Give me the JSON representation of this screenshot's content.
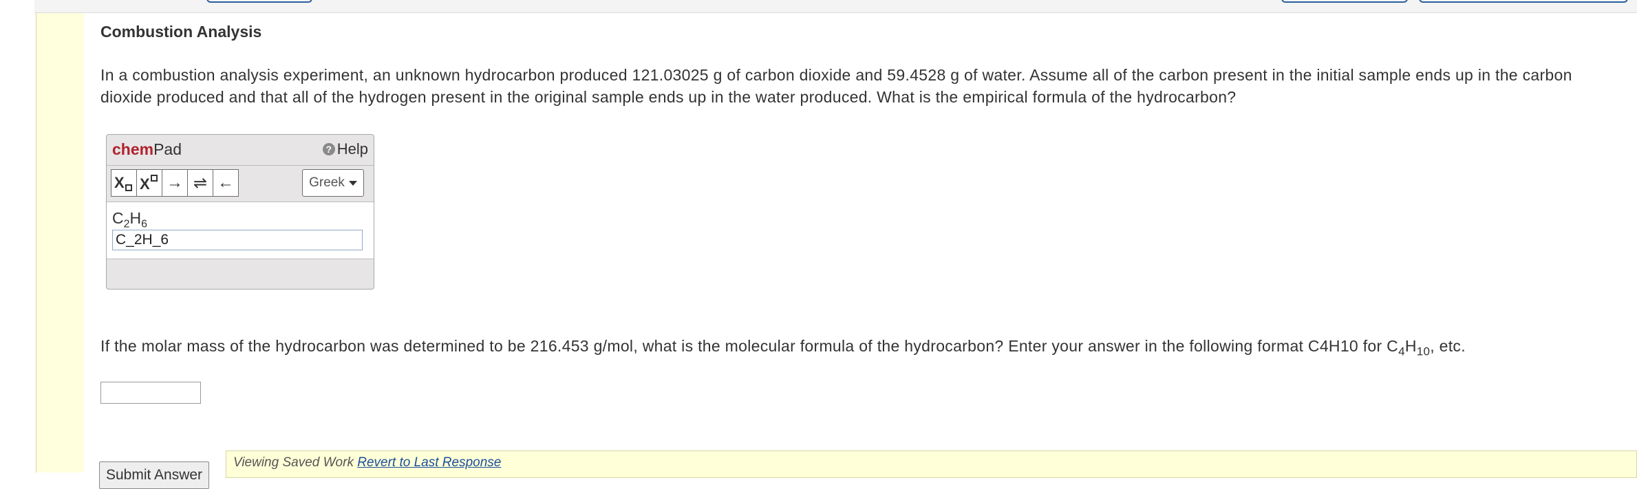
{
  "colors": {
    "rail": "#ffffdd",
    "chem_brand": "#b1212c",
    "link": "#1a4f9c",
    "saved_bar": "#ffffd8"
  },
  "question": {
    "title": "Combustion Analysis",
    "text1": "In a combustion analysis experiment, an unknown hydrocarbon produced 121.03025 g of carbon dioxide and 59.4528 g of water. Assume all of the carbon present in the initial sample ends up in the carbon dioxide produced and that all of the hydrogen present in the original sample ends up in the water produced. What is the empirical formula of the hydrocarbon?",
    "text2_main": "If the molar mass of the hydrocarbon was determined to be 216.453 g/mol, what is the molecular formula of the hydrocarbon? Enter your answer in the following format C4H10 for C",
    "text2_sub1": "4",
    "text2_mid": "H",
    "text2_sub2": "10",
    "text2_end": ", etc."
  },
  "chempad": {
    "brand_chem": "chem",
    "brand_pad": "Pad",
    "help_label": "Help",
    "help_icon": "question-circle-icon",
    "tools": [
      {
        "name": "subscript-button",
        "symbol": "X▫"
      },
      {
        "name": "superscript-button",
        "symbol": "X▫"
      },
      {
        "name": "right-arrow-button",
        "symbol": "→"
      },
      {
        "name": "equilibrium-arrow-button",
        "symbol": "⇌"
      },
      {
        "name": "left-arrow-button",
        "symbol": "←"
      }
    ],
    "greek_label": "Greek",
    "preview_c": "C",
    "preview_c_sub": "2",
    "preview_h": "H",
    "preview_h_sub": "6",
    "input_value": "C_2H_6"
  },
  "answer": {
    "input_value": ""
  },
  "actions": {
    "submit_label": "Submit Answer",
    "saved_text": "Viewing Saved Work",
    "revert_label": "Revert to Last Response"
  }
}
